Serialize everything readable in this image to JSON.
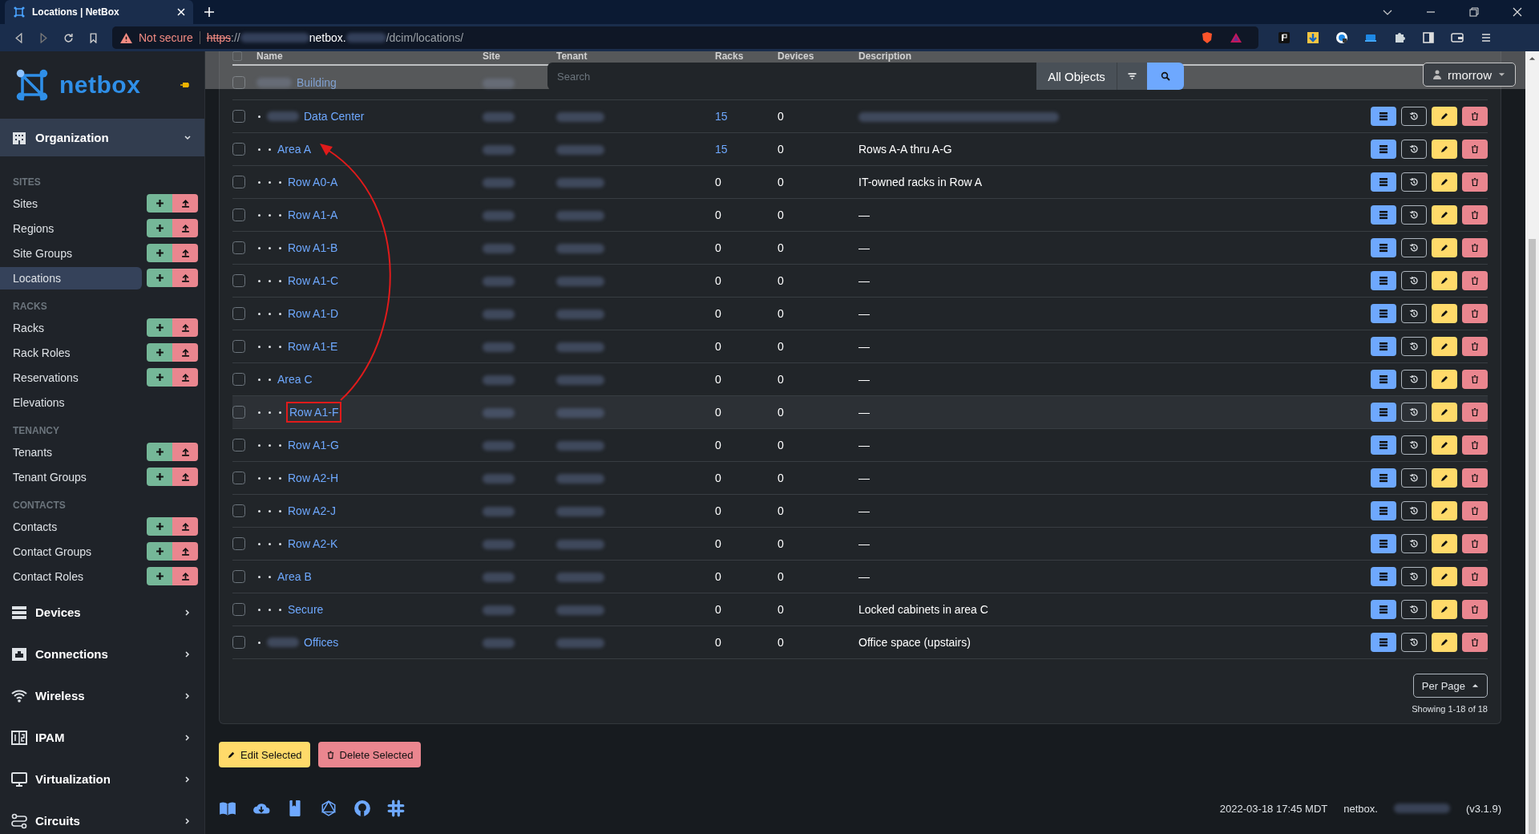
{
  "browser": {
    "tab_title": "Locations | NetBox",
    "security": "Not secure",
    "url_scheme": "https",
    "url_sep": "://",
    "url_host": "netbox.",
    "url_path": "/dcim/locations/"
  },
  "sidebar": {
    "logo": "netbox",
    "menus": [
      {
        "label": "Organization",
        "expanded": true,
        "groups": [
          {
            "heading": "SITES",
            "items": [
              {
                "label": "Sites",
                "selected": false,
                "actions": true
              },
              {
                "label": "Regions",
                "selected": false,
                "actions": true
              },
              {
                "label": "Site Groups",
                "selected": false,
                "actions": true
              },
              {
                "label": "Locations",
                "selected": true,
                "actions": true
              }
            ]
          },
          {
            "heading": "RACKS",
            "items": [
              {
                "label": "Racks",
                "selected": false,
                "actions": true
              },
              {
                "label": "Rack Roles",
                "selected": false,
                "actions": true
              },
              {
                "label": "Reservations",
                "selected": false,
                "actions": true
              },
              {
                "label": "Elevations",
                "selected": false,
                "actions": false
              }
            ]
          },
          {
            "heading": "TENANCY",
            "items": [
              {
                "label": "Tenants",
                "selected": false,
                "actions": true
              },
              {
                "label": "Tenant Groups",
                "selected": false,
                "actions": true
              }
            ]
          },
          {
            "heading": "CONTACTS",
            "items": [
              {
                "label": "Contacts",
                "selected": false,
                "actions": true
              },
              {
                "label": "Contact Groups",
                "selected": false,
                "actions": true
              },
              {
                "label": "Contact Roles",
                "selected": false,
                "actions": true
              }
            ]
          }
        ]
      },
      {
        "label": "Devices",
        "expanded": false
      },
      {
        "label": "Connections",
        "expanded": false
      },
      {
        "label": "Wireless",
        "expanded": false
      },
      {
        "label": "IPAM",
        "expanded": false
      },
      {
        "label": "Virtualization",
        "expanded": false
      },
      {
        "label": "Circuits",
        "expanded": false
      }
    ]
  },
  "search": {
    "placeholder": "Search",
    "scope": "All Objects"
  },
  "user": {
    "name": "rmorrow"
  },
  "table": {
    "select_all_checked": false,
    "columns": [
      "Name",
      "Site",
      "Tenant",
      "Racks",
      "Devices",
      "Description"
    ],
    "rows": [
      {
        "name": "Building",
        "redacted_prefix": true,
        "highlighted": false,
        "annotated": false,
        "children": [
          {
            "name": "Data Center",
            "redacted_prefix": true,
            "racks": "15",
            "racks_link": true,
            "devices": "0",
            "description_redacted": true,
            "highlighted": false,
            "annotated": false,
            "children": [
              {
                "name": "Area A",
                "redacted_prefix": false,
                "racks": "15",
                "racks_link": true,
                "devices": "0",
                "description": "Rows A-A thru A-G",
                "highlighted": false,
                "annotated": false,
                "children": [
                  {
                    "name": "Row A0-A",
                    "redacted_prefix": false,
                    "racks": "0",
                    "racks_link": false,
                    "devices": "0",
                    "description": "IT-owned racks in Row A",
                    "highlighted": false,
                    "annotated": false
                  },
                  {
                    "name": "Row A1-A",
                    "redacted_prefix": false,
                    "racks": "0",
                    "racks_link": false,
                    "devices": "0",
                    "description": "—",
                    "highlighted": false,
                    "annotated": false
                  },
                  {
                    "name": "Row A1-B",
                    "redacted_prefix": false,
                    "racks": "0",
                    "racks_link": false,
                    "devices": "0",
                    "description": "—",
                    "highlighted": false,
                    "annotated": false
                  },
                  {
                    "name": "Row A1-C",
                    "redacted_prefix": false,
                    "racks": "0",
                    "racks_link": false,
                    "devices": "0",
                    "description": "—",
                    "highlighted": false,
                    "annotated": false
                  },
                  {
                    "name": "Row A1-D",
                    "redacted_prefix": false,
                    "racks": "0",
                    "racks_link": false,
                    "devices": "0",
                    "description": "—",
                    "highlighted": false,
                    "annotated": false
                  },
                  {
                    "name": "Row A1-E",
                    "redacted_prefix": false,
                    "racks": "0",
                    "racks_link": false,
                    "devices": "0",
                    "description": "—",
                    "highlighted": false,
                    "annotated": false
                  }
                ]
              },
              {
                "name": "Area C",
                "redacted_prefix": false,
                "racks": "0",
                "racks_link": false,
                "devices": "0",
                "description": "—",
                "highlighted": false,
                "annotated": false,
                "children": [
                  {
                    "name": "Row A1-F",
                    "redacted_prefix": false,
                    "racks": "0",
                    "racks_link": false,
                    "devices": "0",
                    "description": "—",
                    "highlighted": true,
                    "annotated": true
                  },
                  {
                    "name": "Row A1-G",
                    "redacted_prefix": false,
                    "racks": "0",
                    "racks_link": false,
                    "devices": "0",
                    "description": "—",
                    "highlighted": false,
                    "annotated": false
                  },
                  {
                    "name": "Row A2-H",
                    "redacted_prefix": false,
                    "racks": "0",
                    "racks_link": false,
                    "devices": "0",
                    "description": "—",
                    "highlighted": false,
                    "annotated": false
                  },
                  {
                    "name": "Row A2-J",
                    "redacted_prefix": false,
                    "racks": "0",
                    "racks_link": false,
                    "devices": "0",
                    "description": "—",
                    "highlighted": false,
                    "annotated": false
                  },
                  {
                    "name": "Row A2-K",
                    "redacted_prefix": false,
                    "racks": "0",
                    "racks_link": false,
                    "devices": "0",
                    "description": "—",
                    "highlighted": false,
                    "annotated": false
                  }
                ]
              },
              {
                "name": "Area B",
                "redacted_prefix": false,
                "racks": "0",
                "racks_link": false,
                "devices": "0",
                "description": "—",
                "highlighted": false,
                "annotated": false,
                "children": [
                  {
                    "name": "Secure",
                    "redacted_prefix": false,
                    "racks": "0",
                    "racks_link": false,
                    "devices": "0",
                    "description": "Locked cabinets in area C",
                    "highlighted": false,
                    "annotated": false
                  }
                ]
              }
            ]
          },
          {
            "name": "Offices",
            "redacted_prefix": true,
            "racks": "0",
            "racks_link": false,
            "devices": "0",
            "description": "Office space (upstairs)",
            "highlighted": false,
            "annotated": false
          }
        ]
      }
    ]
  },
  "pagination": {
    "per_page": "Per Page",
    "summary": "Showing 1-18 of 18"
  },
  "bulk_actions": [
    {
      "label": "Edit Selected",
      "kind": "edit"
    },
    {
      "label": "Delete Selected",
      "kind": "delete"
    }
  ],
  "footer": {
    "timestamp": "2022-03-18 17:45 MDT",
    "host": "netbox.",
    "version": "(v3.1.9)"
  }
}
